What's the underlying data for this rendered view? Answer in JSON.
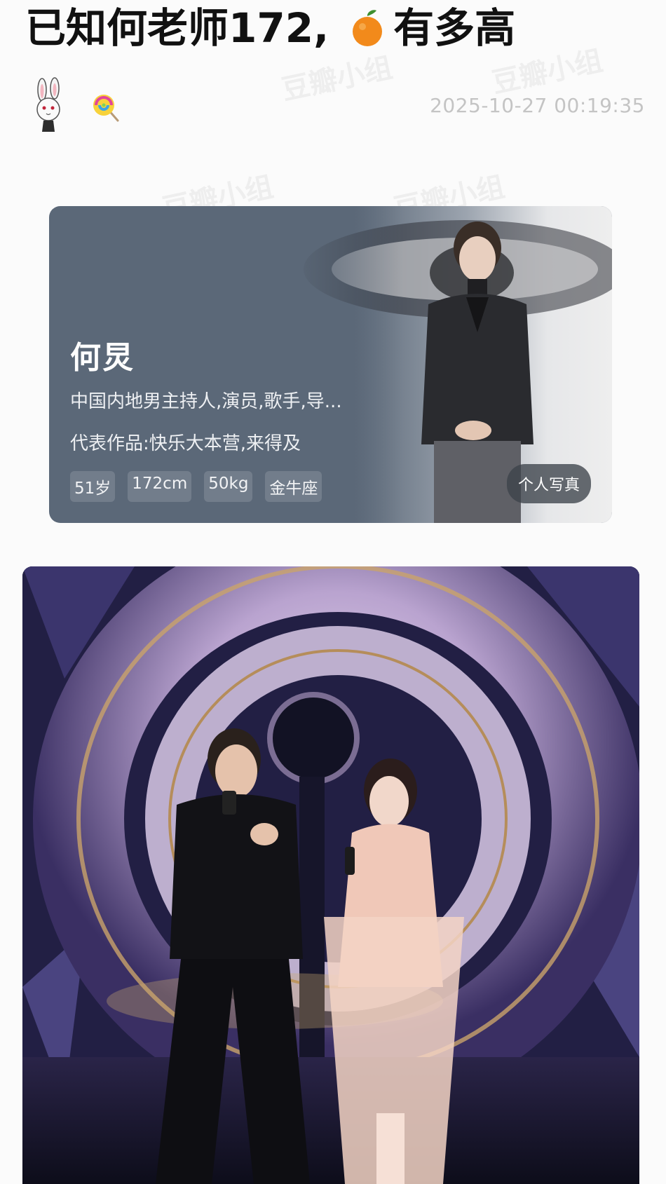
{
  "post": {
    "title_part1": "已知何老师172,",
    "title_part2": "有多高",
    "timestamp": "2025-10-27 00:19:35"
  },
  "watermark": {
    "text": "豆瓣小组"
  },
  "baike_card": {
    "name": "何炅",
    "description": "中国内地男主持人,演员,歌手,导...",
    "works": "代表作品:快乐大本营,来得及",
    "tags": [
      "51岁",
      "172cm",
      "50kg",
      "金牛座"
    ],
    "photo_button": "个人写真"
  },
  "icons": {
    "title_emoji": "orange-icon",
    "author_avatar": "bunny-avatar-icon",
    "author_badge": "lollipop-icon"
  },
  "colors": {
    "card_bg": "#5b6878",
    "timestamp": "#c4c4c4"
  }
}
